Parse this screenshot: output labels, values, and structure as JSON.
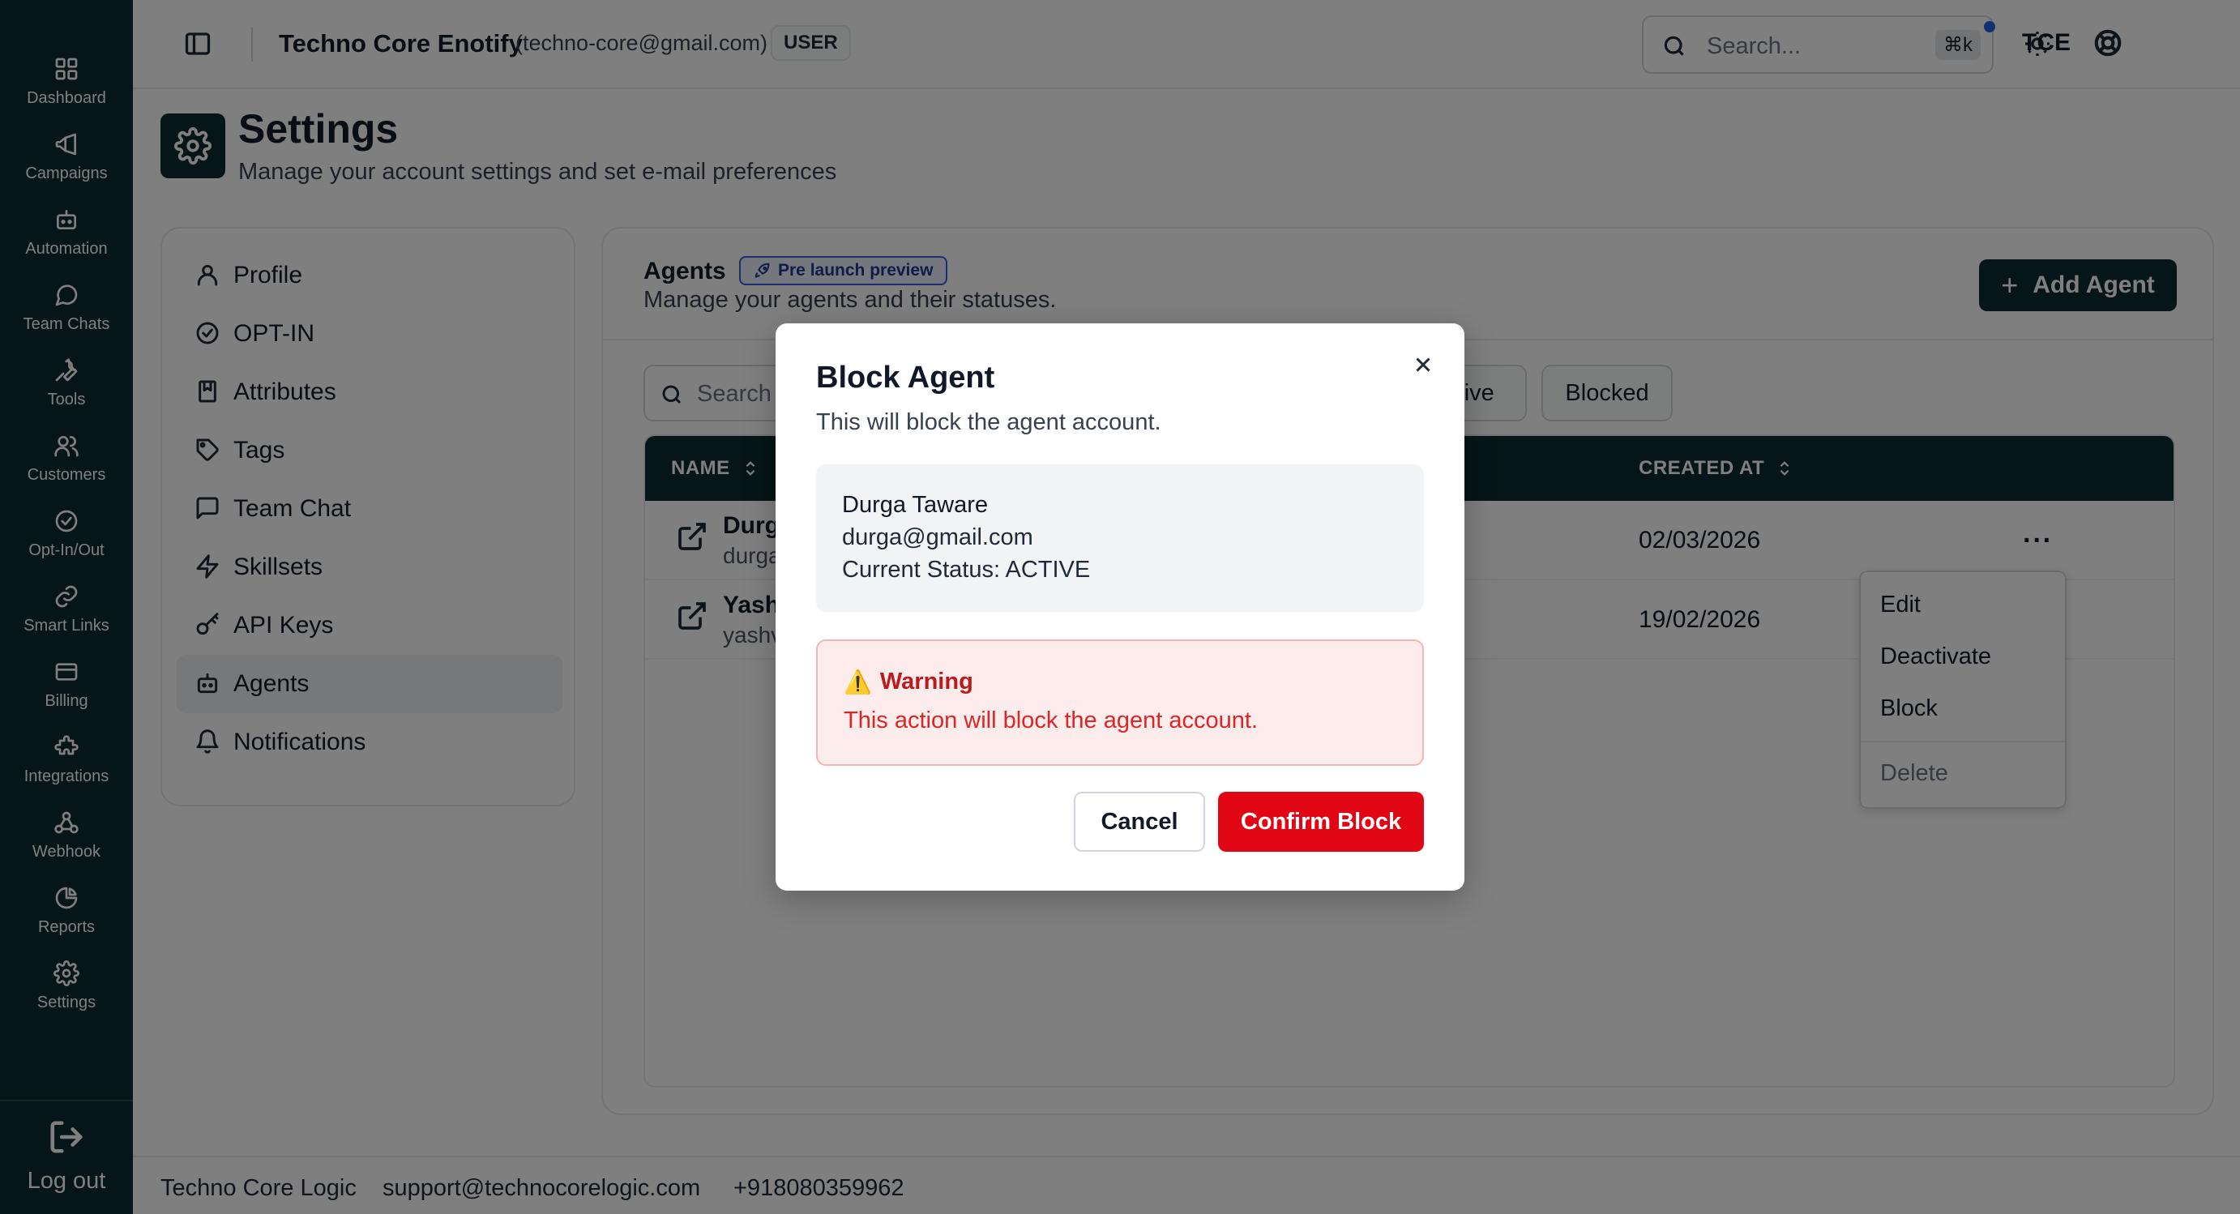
{
  "rail": {
    "items": [
      {
        "label": "Dashboard",
        "icon": "dashboard-icon"
      },
      {
        "label": "Campaigns",
        "icon": "megaphone-icon"
      },
      {
        "label": "Automation",
        "icon": "bot-icon"
      },
      {
        "label": "Team Chats",
        "icon": "chat-icon"
      },
      {
        "label": "Tools",
        "icon": "wrench-icon"
      },
      {
        "label": "Customers",
        "icon": "users-icon"
      },
      {
        "label": "Opt-In/Out",
        "icon": "check-circle-icon"
      },
      {
        "label": "Smart Links",
        "icon": "link-icon"
      },
      {
        "label": "Billing",
        "icon": "card-icon"
      },
      {
        "label": "Integrations",
        "icon": "puzzle-icon"
      },
      {
        "label": "Webhook",
        "icon": "webhook-icon"
      },
      {
        "label": "Reports",
        "icon": "pie-icon"
      },
      {
        "label": "Settings",
        "icon": "gear-icon"
      }
    ],
    "logout_label": "Log out"
  },
  "topbar": {
    "org_name": "Techno Core Enotify",
    "org_email": "(techno-core@gmail.com)",
    "role": "USER",
    "search_placeholder": "Search...",
    "shortcut": "⌘k",
    "avatar": "TCE"
  },
  "page": {
    "title": "Settings",
    "subtitle": "Manage your account settings and set e-mail preferences"
  },
  "settings_nav": {
    "items": [
      {
        "label": "Profile",
        "icon": "user-icon"
      },
      {
        "label": "OPT-IN",
        "icon": "check-circle-icon"
      },
      {
        "label": "Attributes",
        "icon": "bookmark-icon"
      },
      {
        "label": "Tags",
        "icon": "tag-icon"
      },
      {
        "label": "Team Chat",
        "icon": "message-square-icon"
      },
      {
        "label": "Skillsets",
        "icon": "zap-icon"
      },
      {
        "label": "API Keys",
        "icon": "key-icon"
      },
      {
        "label": "Agents",
        "icon": "bot-icon"
      },
      {
        "label": "Notifications",
        "icon": "bell-icon"
      }
    ],
    "active": "Agents"
  },
  "agents": {
    "title": "Agents",
    "badge": "Pre launch preview",
    "subtitle": "Manage your agents and their statuses.",
    "add_label": "Add Agent",
    "search_placeholder": "Search",
    "filters": [
      "ctive",
      "Blocked"
    ],
    "columns": {
      "name": "NAME",
      "created_at": "CREATED AT"
    },
    "rows": [
      {
        "name": "Durg",
        "email": "durga",
        "created": "02/03/2026"
      },
      {
        "name": "Yash",
        "email": "yashv",
        "created": "19/02/2026"
      }
    ],
    "more": "···"
  },
  "row_menu": {
    "items": [
      "Edit",
      "Deactivate",
      "Block"
    ],
    "danger": "Delete"
  },
  "modal": {
    "title": "Block Agent",
    "description": "This will block the agent account.",
    "agent_name": "Durga Taware",
    "agent_email": "durga@gmail.com",
    "agent_status": "Current Status: ACTIVE",
    "warning_title": "Warning",
    "warning_icon": "⚠️",
    "warning_message": "This action will block the agent account.",
    "cancel_label": "Cancel",
    "confirm_label": "Confirm Block"
  },
  "footer": {
    "company": "Techno Core Logic",
    "email": "support@technocorelogic.com",
    "phone": "+918080359962"
  },
  "colors": {
    "brand_dark": "#0d2b2f",
    "danger": "#e00613",
    "warning_bg": "#fdecec"
  }
}
